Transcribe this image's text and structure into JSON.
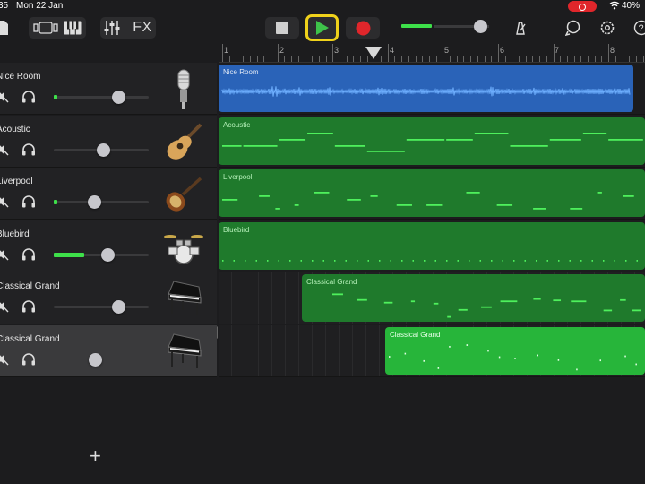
{
  "status_bar": {
    "time": "35",
    "date": "Mon 22 Jan",
    "battery": "40%"
  },
  "toolbar": {
    "fx_label": "FX",
    "icons": [
      "browser-icon",
      "view-toggle-icon",
      "keyboard-icon",
      "mixer-icon",
      "fx-icon",
      "stop-icon",
      "play-icon",
      "record-icon",
      "master-volume-icon",
      "metronome-icon",
      "loop-icon",
      "settings-icon",
      "help-icon"
    ],
    "colors": {
      "play": "#3ec34a",
      "play_highlight": "#f0d21b",
      "record": "#e0262b",
      "meter": "#3ee04a"
    }
  },
  "ruler": {
    "bars": [
      "1",
      "2",
      "3",
      "4",
      "5",
      "6",
      "7",
      "8"
    ]
  },
  "tracks": [
    {
      "name": "Nice Room",
      "instrument": "microphone-icon",
      "volume": 0.68,
      "meter": 0.04
    },
    {
      "name": "Acoustic",
      "instrument": "acoustic-guitar-icon",
      "volume": 0.52,
      "meter": 0
    },
    {
      "name": "Liverpool",
      "instrument": "bass-guitar-icon",
      "volume": 0.42,
      "meter": 0.04
    },
    {
      "name": "Bluebird",
      "instrument": "drum-kit-icon",
      "volume": 0.57,
      "meter": 0.32
    },
    {
      "name": "Classical Grand",
      "instrument": "grand-piano-icon",
      "volume": 0.68,
      "meter": 0
    },
    {
      "name": "Classical Grand",
      "instrument": "grand-piano-icon",
      "volume": 0.43,
      "meter": 0,
      "selected": true
    }
  ],
  "regions": [
    {
      "label": "Nice Room",
      "kind": "audio",
      "color": "#2a63b8"
    },
    {
      "label": "Acoustic",
      "kind": "midi",
      "color": "#1f7a2c"
    },
    {
      "label": "Liverpool",
      "kind": "midi",
      "color": "#1f7a2c"
    },
    {
      "label": "Bluebird",
      "kind": "midi",
      "color": "#1f7a2c"
    },
    {
      "label": "Classical Grand",
      "kind": "midi",
      "color": "#1f7a2c"
    },
    {
      "label": "Classical Grand",
      "kind": "midi",
      "color": "#27b53a"
    }
  ],
  "add_track_label": "+"
}
